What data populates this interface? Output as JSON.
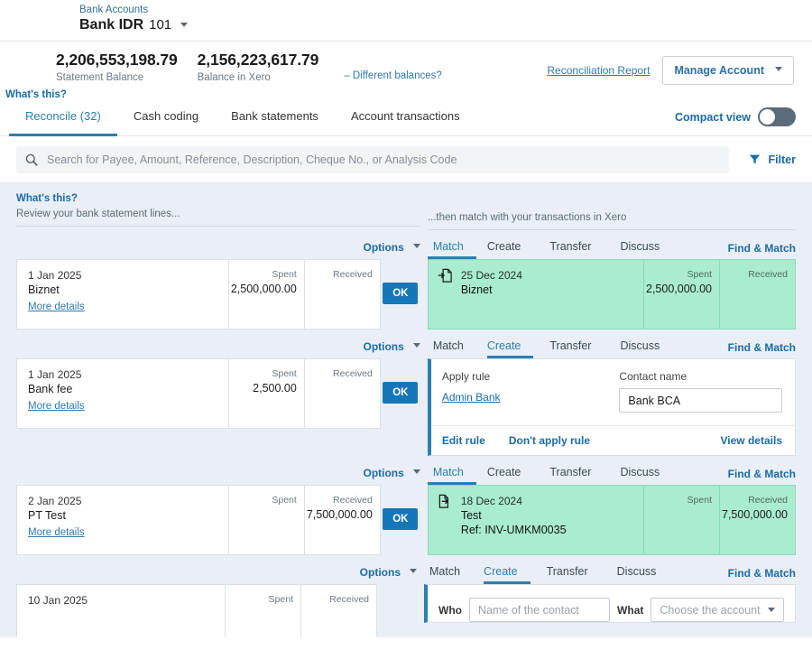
{
  "account": {
    "breadcrumb": "Bank Accounts",
    "name": "Bank IDR",
    "number": "101"
  },
  "balances": {
    "statement_amount": "2,206,553,198.79",
    "statement_label": "Statement Balance",
    "xero_amount": "2,156,223,617.79",
    "xero_label": "Balance in Xero",
    "different_link": "– Different balances?",
    "reconciliation_report": "Reconciliation Report",
    "manage_account": "Manage Account",
    "whats_this": "What's this?"
  },
  "tabs": [
    {
      "label": "Reconcile (32)",
      "active": true
    },
    {
      "label": "Cash coding",
      "active": false
    },
    {
      "label": "Bank statements",
      "active": false
    },
    {
      "label": "Account transactions",
      "active": false
    }
  ],
  "compact_view": {
    "label": "Compact view",
    "enabled": false
  },
  "search": {
    "placeholder": "Search for Payee, Amount, Reference, Description, Cheque No., or Analysis Code",
    "value": "",
    "filter_label": "Filter"
  },
  "columns": {
    "left_whats_this": "What's this?",
    "left_sub": "Review your bank statement lines...",
    "right_sub": "...then match with your transactions in Xero"
  },
  "labels": {
    "options": "Options",
    "spent": "Spent",
    "received": "Received",
    "more_details": "More details",
    "ok": "OK",
    "find_and_match": "Find & Match"
  },
  "match_tabs": [
    "Match",
    "Create",
    "Transfer",
    "Discuss"
  ],
  "rows": [
    {
      "statement": {
        "date": "1 Jan 2025",
        "payee": "Biznet",
        "more_details": "More details",
        "spent": "2,500,000.00",
        "received": ""
      },
      "active_tab": "Match",
      "panel": "match",
      "match": {
        "icon": "invoice-out-icon",
        "date": "25 Dec 2024",
        "name": "Biznet",
        "reference": "",
        "spent": "2,500,000.00",
        "received": ""
      }
    },
    {
      "statement": {
        "date": "1 Jan 2025",
        "payee": "Bank fee",
        "more_details": "More details",
        "spent": "2,500.00",
        "received": ""
      },
      "active_tab": "Create",
      "panel": "create-rule",
      "create": {
        "apply_rule_label": "Apply rule",
        "rule_name": "Admin Bank",
        "contact_label": "Contact name",
        "contact_value": "Bank BCA",
        "edit_rule": "Edit rule",
        "dont_apply_rule": "Don't apply rule",
        "view_details": "View details"
      }
    },
    {
      "statement": {
        "date": "2 Jan 2025",
        "payee": "PT Test",
        "more_details": "More details",
        "spent": "",
        "received": "7,500,000.00"
      },
      "active_tab": "Match",
      "panel": "match",
      "match": {
        "icon": "invoice-in-icon",
        "date": "18 Dec 2024",
        "name": "Test",
        "reference": "Ref: INV-UMKM0035",
        "spent": "",
        "received": "7,500,000.00"
      }
    },
    {
      "statement": {
        "date": "10 Jan 2025",
        "payee": "",
        "more_details": "",
        "spent": "",
        "received": ""
      },
      "active_tab": "Create",
      "panel": "create-form",
      "create_form": {
        "who_label": "Who",
        "who_placeholder": "Name of the contact",
        "what_label": "What",
        "what_placeholder": "Choose the account"
      }
    }
  ],
  "colors": {
    "accent_blue": "#2a7fb5",
    "link_blue": "#1a6ba8",
    "match_green": "#a9ecd0",
    "body_bg": "#eaeff7",
    "ok_button": "#1577b8"
  }
}
